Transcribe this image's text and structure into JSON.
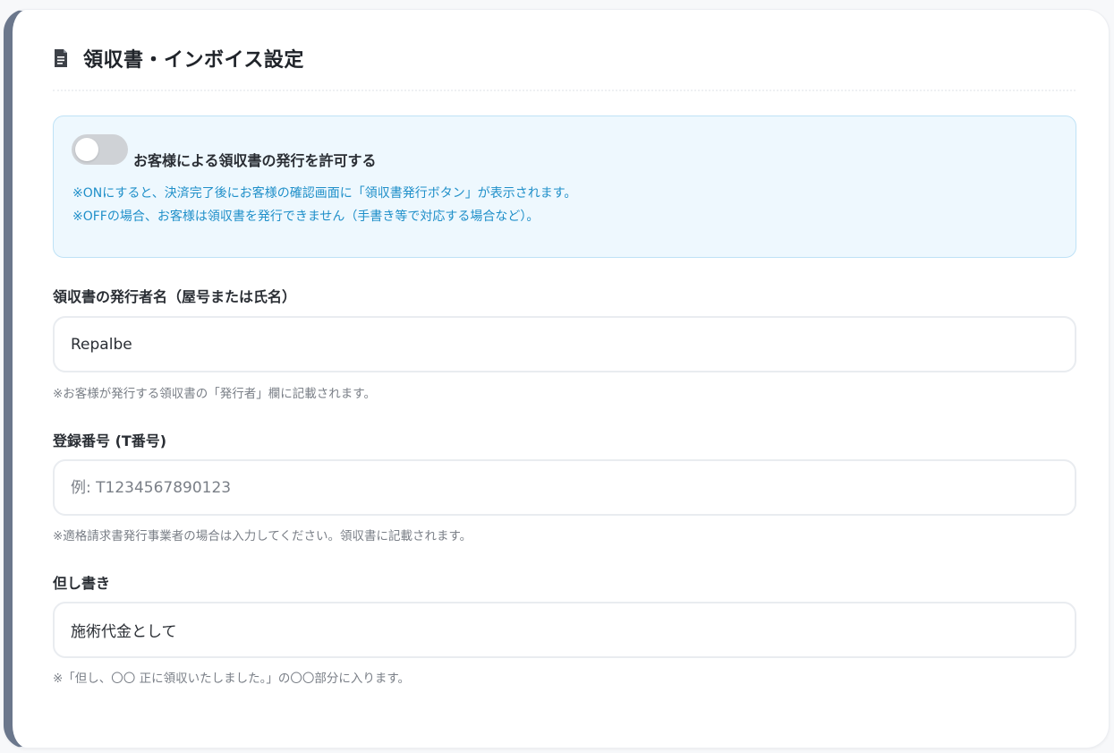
{
  "header": {
    "icon": "document-icon",
    "title": "領収書・インボイス設定"
  },
  "receipt_toggle": {
    "label": "お客様による領収書の発行を許可する",
    "state": "off",
    "note_on": "※ONにすると、決済完了後にお客様の確認画面に「領収書発行ボタン」が表示されます。",
    "note_off": "※OFFの場合、お客様は領収書を発行できません（手書き等で対応する場合など）。"
  },
  "issuer": {
    "label": "領収書の発行者名（屋号または氏名）",
    "value": "Repalbe",
    "help": "※お客様が発行する領収書の「発行者」欄に記載されます。"
  },
  "registration": {
    "label": "登録番号 (T番号)",
    "value": "",
    "placeholder": "例: T1234567890123",
    "help": "※適格請求書発行事業者の場合は入力してください。領収書に記載されます。"
  },
  "proviso": {
    "label": "但し書き",
    "value": "施術代金として",
    "help": "※「但し、〇〇 正に領収いたしました。」の〇〇部分に入ります。"
  },
  "colors": {
    "accent_border": "#6b778c",
    "info_bg": "#eef8fe",
    "info_text": "#1f8fc9",
    "toggle_off": "#cfd2d6"
  }
}
